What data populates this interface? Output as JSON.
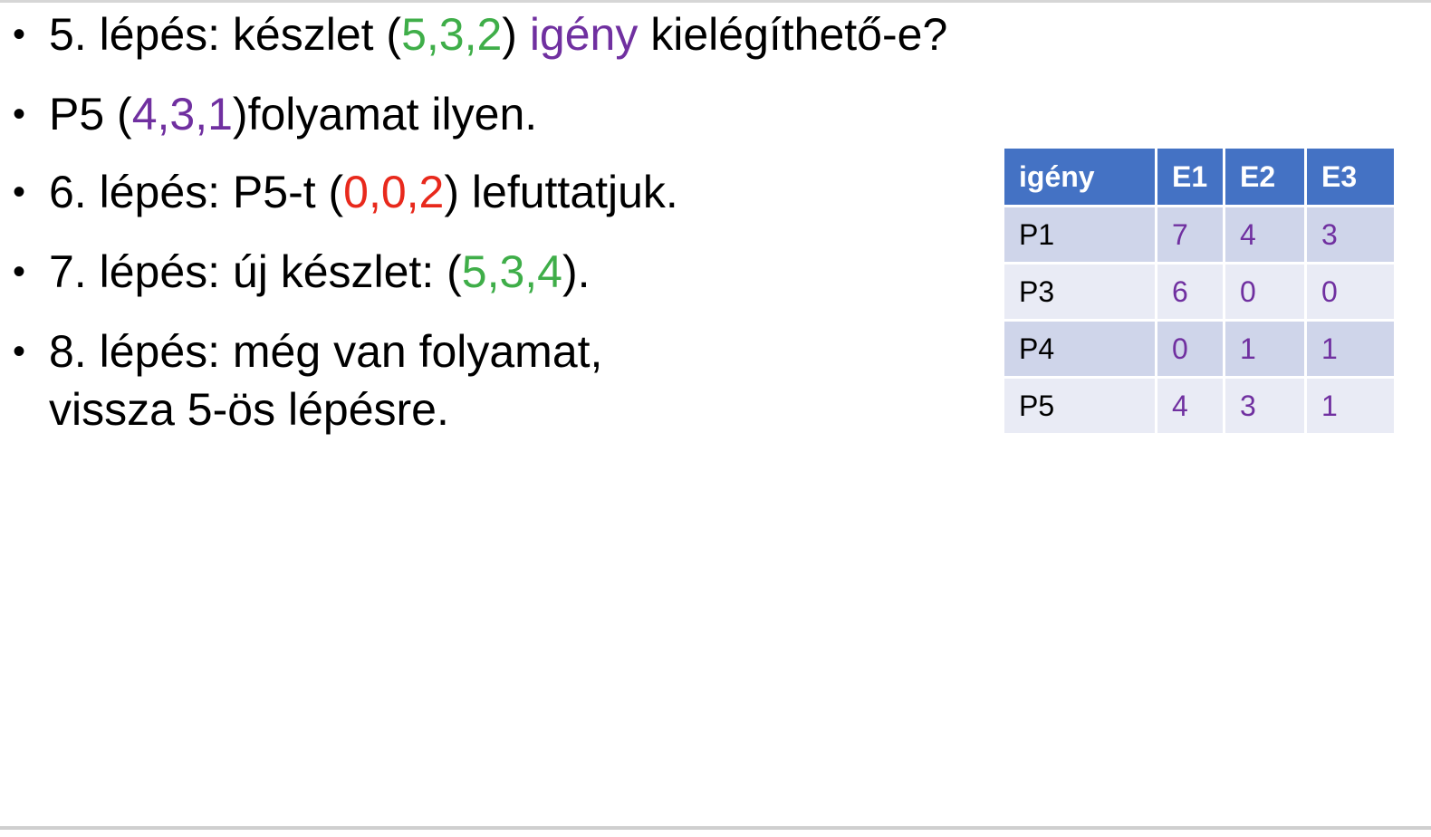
{
  "bullets": [
    {
      "parts": [
        {
          "text": "5. lépés: készlet (",
          "color": "default"
        },
        {
          "text": "5,3,2",
          "color": "green"
        },
        {
          "text": ") ",
          "color": "default"
        },
        {
          "text": "igény",
          "color": "purple"
        },
        {
          "text": " kielégíthető-e?",
          "color": "default"
        }
      ]
    },
    {
      "parts": [
        {
          "text": "P5 (",
          "color": "default"
        },
        {
          "text": "4,3,1",
          "color": "purple"
        },
        {
          "text": ")folyamat ilyen.",
          "color": "default"
        }
      ]
    },
    {
      "parts": [
        {
          "text": "6. lépés: P5-t (",
          "color": "default"
        },
        {
          "text": "0,0,2",
          "color": "red"
        },
        {
          "text": ") lefuttatjuk.",
          "color": "default"
        }
      ]
    },
    {
      "parts": [
        {
          "text": "7. lépés: új készlet: (",
          "color": "default"
        },
        {
          "text": "5,3,4",
          "color": "green"
        },
        {
          "text": ").",
          "color": "default"
        }
      ]
    },
    {
      "lines": [
        "8. lépés: még van folyamat,",
        "vissza 5-ös lépésre."
      ]
    }
  ],
  "table": {
    "headers": [
      "igény",
      "E1",
      "E2",
      "E3"
    ],
    "rows": [
      {
        "name": "P1",
        "values": [
          "7",
          "4",
          "3"
        ]
      },
      {
        "name": "P3",
        "values": [
          "6",
          "0",
          "0"
        ]
      },
      {
        "name": "P4",
        "values": [
          "0",
          "1",
          "1"
        ]
      },
      {
        "name": "P5",
        "values": [
          "4",
          "3",
          "1"
        ]
      }
    ]
  },
  "colors": {
    "green": "#3fae49",
    "purple": "#7030a0",
    "red": "#e8291c",
    "header_blue": "#4472c4",
    "row_band_dark": "#cfd5ea",
    "row_band_light": "#e9ebf5"
  }
}
